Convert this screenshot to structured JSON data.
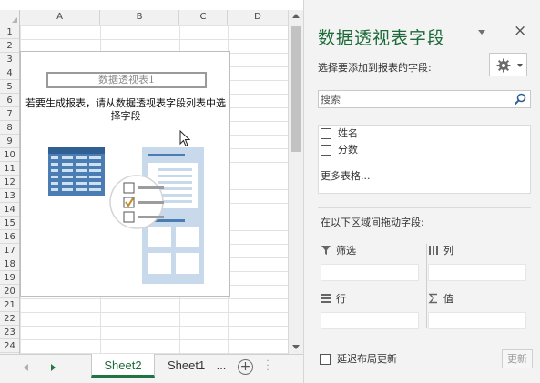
{
  "sheet": {
    "columns": [
      "A",
      "B",
      "C",
      "D"
    ],
    "rows": [
      "1",
      "2",
      "3",
      "4",
      "5",
      "6",
      "7",
      "8",
      "9",
      "10",
      "11",
      "12",
      "13",
      "14",
      "15",
      "16",
      "17",
      "18",
      "19",
      "20",
      "21",
      "22",
      "23",
      "24"
    ],
    "pivot_placeholder": {
      "title": "数据透视表1",
      "hint": "若要生成报表，请从数据透视表字段列表中选择字段"
    },
    "tabs": [
      "Sheet2",
      "Sheet1",
      "..."
    ],
    "active_tab": "Sheet2",
    "add_sheet_symbol": "+",
    "accent_color": "#217346"
  },
  "pane": {
    "title": "数据透视表字段",
    "close_symbol": "×",
    "choose_label": "选择要添加到报表的字段:",
    "search_placeholder": "搜索",
    "fields": [
      {
        "name": "姓名",
        "checked": false
      },
      {
        "name": "分数",
        "checked": false
      }
    ],
    "more_tables": "更多表格...",
    "drag_label": "在以下区域间拖动字段:",
    "areas": {
      "filter": {
        "label": "筛选",
        "icon": "filter-icon"
      },
      "columns": {
        "label": "列",
        "icon": "columns-icon"
      },
      "rows": {
        "label": "行",
        "icon": "rows-icon"
      },
      "values": {
        "label": "值",
        "icon": "sigma-icon"
      }
    },
    "defer_label": "延迟布局更新",
    "update_button": "更新",
    "title_color": "#1d6b3b"
  }
}
